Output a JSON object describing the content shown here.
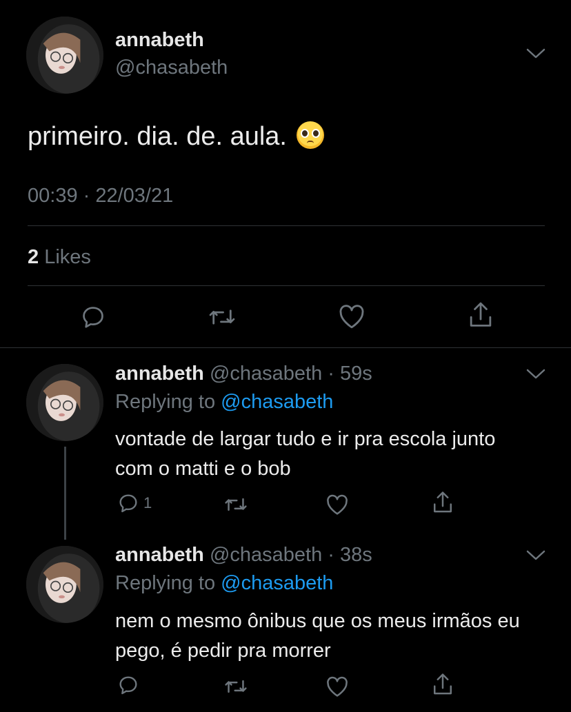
{
  "tweet": {
    "author_name": "annabeth",
    "author_handle": "@chasabeth",
    "text": "primeiro. dia. de. aula.",
    "emoji_icon": "pleading-face-emoji",
    "timestamp": "00:39 · 22/03/21",
    "likes_count": "2",
    "likes_label": "Likes"
  },
  "replies": [
    {
      "author_name": "annabeth",
      "handle_time": "@chasabeth · 59s",
      "replying_prefix": "Replying to",
      "replying_to": "@chasabeth",
      "text": "vontade de largar tudo e ir pra escola junto com o matti e o bob",
      "reply_count": "1"
    },
    {
      "author_name": "annabeth",
      "handle_time": "@chasabeth · 38s",
      "replying_prefix": "Replying to",
      "replying_to": "@chasabeth",
      "text": "nem o mesmo ônibus que os meus irmãos eu pego, é pedir pra morrer",
      "reply_count": ""
    }
  ],
  "colors": {
    "background": "#000000",
    "muted": "#6e767d",
    "link": "#1d9bf0",
    "divider": "#2f3336"
  },
  "icons": [
    "chevron-down-icon",
    "reply-icon",
    "retweet-icon",
    "like-icon",
    "share-icon"
  ]
}
